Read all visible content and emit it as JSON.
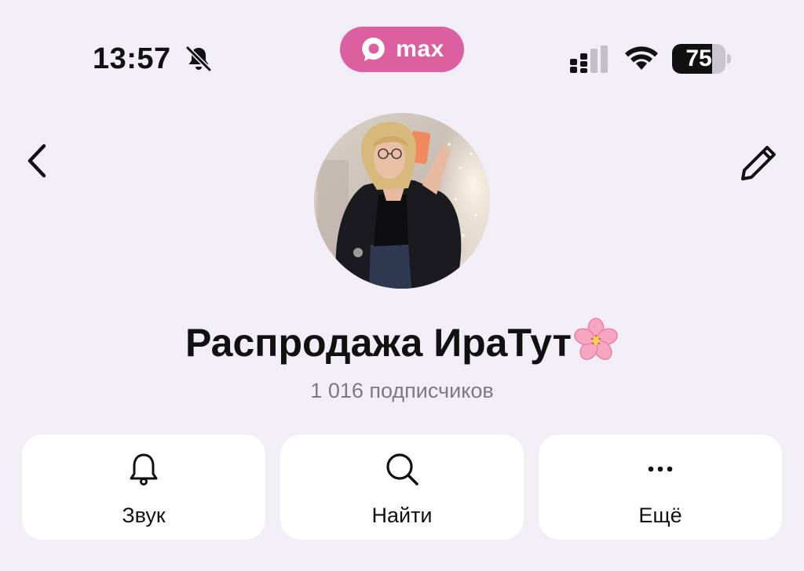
{
  "status_bar": {
    "time": "13:57",
    "bell_icon": "bell-slash-icon",
    "app_badge": "max",
    "battery_level": "75",
    "battery_fraction": 0.75
  },
  "header": {
    "back_icon": "chevron-left-icon",
    "edit_icon": "pencil-icon"
  },
  "profile": {
    "name": "Распродажа ИраТут",
    "name_emoji": "cherry-blossom-icon",
    "subscribers": "1 016 подписчиков"
  },
  "actions": [
    {
      "label": "Звук",
      "icon": "bell-icon"
    },
    {
      "label": "Найти",
      "icon": "search-icon"
    },
    {
      "label": "Ещё",
      "icon": "more-dots-icon"
    }
  ],
  "colors": {
    "background": "#f1eff5",
    "accent": "#dc5f9f",
    "card": "#ffffff",
    "muted_text": "#7d7b82"
  }
}
